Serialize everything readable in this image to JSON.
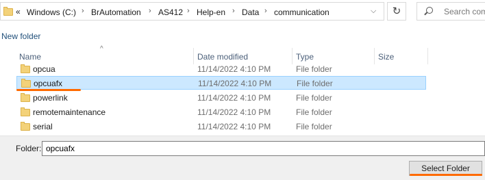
{
  "address": {
    "overflow_glyph": "«",
    "crumbs": [
      "Windows (C:)",
      "BrAutomation",
      "AS412",
      "Help-en",
      "Data",
      "communication"
    ]
  },
  "search": {
    "placeholder": "Search com"
  },
  "toolbar": {
    "new_folder_label": "New folder"
  },
  "columns": {
    "name": "Name",
    "date": "Date modified",
    "type": "Type",
    "size": "Size"
  },
  "files": [
    {
      "name": "opcua",
      "date": "11/14/2022 4:10 PM",
      "type": "File folder",
      "selected": false
    },
    {
      "name": "opcuafx",
      "date": "11/14/2022 4:10 PM",
      "type": "File folder",
      "selected": true
    },
    {
      "name": "powerlink",
      "date": "11/14/2022 4:10 PM",
      "type": "File folder",
      "selected": false
    },
    {
      "name": "remotemaintenance",
      "date": "11/14/2022 4:10 PM",
      "type": "File folder",
      "selected": false
    },
    {
      "name": "serial",
      "date": "11/14/2022 4:10 PM",
      "type": "File folder",
      "selected": false
    }
  ],
  "footer": {
    "folder_label": "Folder:",
    "folder_value": "opcuafx",
    "select_button_label": "Select Folder"
  },
  "colors": {
    "highlight": "#ff6a00",
    "selection": "#cce8ff",
    "folder": "#f3d27a"
  }
}
